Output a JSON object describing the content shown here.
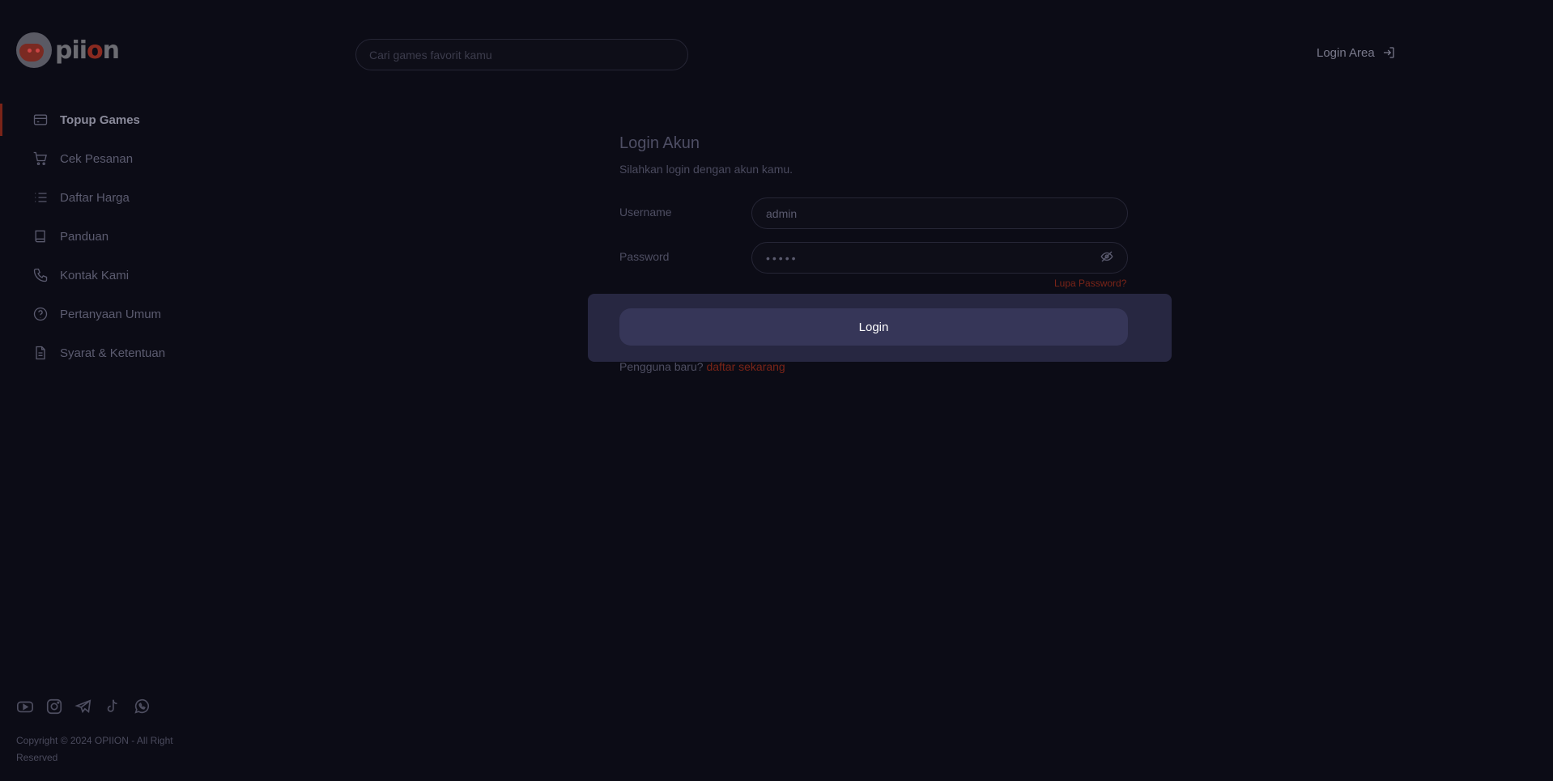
{
  "brand": {
    "logo_text_prefix": "pii",
    "logo_text_o": "o",
    "logo_text_suffix": "n"
  },
  "header": {
    "search_placeholder": "Cari games favorit kamu",
    "login_area_label": "Login Area"
  },
  "sidebar": {
    "items": [
      {
        "label": "Topup Games",
        "icon": "credit-card-icon",
        "active": true
      },
      {
        "label": "Cek Pesanan",
        "icon": "cart-icon"
      },
      {
        "label": "Daftar Harga",
        "icon": "list-icon"
      },
      {
        "label": "Panduan",
        "icon": "book-icon"
      },
      {
        "label": "Kontak Kami",
        "icon": "phone-icon"
      },
      {
        "label": "Pertanyaan Umum",
        "icon": "question-icon"
      },
      {
        "label": "Syarat & Ketentuan",
        "icon": "document-icon"
      }
    ],
    "socials": [
      "youtube-icon",
      "instagram-icon",
      "telegram-icon",
      "tiktok-icon",
      "whatsapp-icon"
    ],
    "copyright": "Copyright © 2024 OPIION - All Right Reserved"
  },
  "login_form": {
    "title": "Login Akun",
    "subtitle": "Silahkan login dengan akun kamu.",
    "username_label": "Username",
    "username_value": "admin",
    "password_label": "Password",
    "password_value": "•••••",
    "forgot_password": "Lupa Password?",
    "submit_label": "Login",
    "register_prompt": "Pengguna baru?",
    "register_link": "daftar sekarang"
  },
  "colors": {
    "background": "#0c0c16",
    "accent": "#7a2418",
    "panel": "#272741",
    "button": "#363658"
  }
}
